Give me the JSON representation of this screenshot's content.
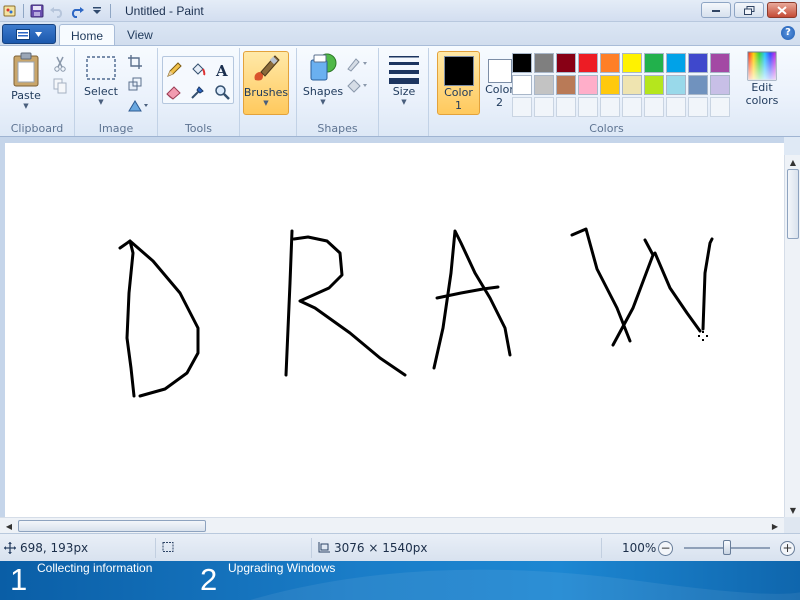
{
  "window": {
    "title": "Untitled - Paint"
  },
  "tabs": [
    {
      "label": "Home",
      "active": true
    },
    {
      "label": "View",
      "active": false
    }
  ],
  "ribbon": {
    "clipboard": {
      "group_label": "Clipboard",
      "paste_label": "Paste"
    },
    "image": {
      "group_label": "Image",
      "select_label": "Select"
    },
    "tools": {
      "group_label": "Tools"
    },
    "brushes": {
      "label": "Brushes"
    },
    "shapes": {
      "group_label": "Shapes",
      "shapes_label": "Shapes"
    },
    "size": {
      "label": "Size"
    },
    "colors": {
      "group_label": "Colors",
      "color1_label": "Color\n1",
      "color1_line1": "Color",
      "color1_line2": "1",
      "color1_value": "#000000",
      "color2_line1": "Color",
      "color2_line2": "2",
      "color2_value": "#ffffff",
      "edit_line1": "Edit",
      "edit_line2": "colors",
      "palette_row1": [
        "#000000",
        "#7f7f7f",
        "#880015",
        "#ed1c24",
        "#ff7f27",
        "#fff200",
        "#22b14c",
        "#00a2e8",
        "#3f48cc",
        "#a349a4"
      ],
      "palette_row2": [
        "#ffffff",
        "#c3c3c3",
        "#b97a57",
        "#ffaec9",
        "#ffc90e",
        "#efe4b0",
        "#b5e61d",
        "#99d9ea",
        "#7092be",
        "#c8bfe7"
      ]
    }
  },
  "canvas": {
    "drawing_text": "DRAW",
    "stroke_color": "#000000"
  },
  "status": {
    "cursor_pos": "698, 193px",
    "image_size": "3076 × 1540px",
    "zoom": "100%",
    "zoom_fraction": 0.5
  },
  "setup": {
    "steps": [
      {
        "number": "1",
        "label": "Collecting information"
      },
      {
        "number": "2",
        "label": "Upgrading Windows"
      }
    ]
  },
  "accent_colors": {
    "ribbon_selected": "#ffc95d",
    "setup_banner": "#1a7dc8"
  }
}
